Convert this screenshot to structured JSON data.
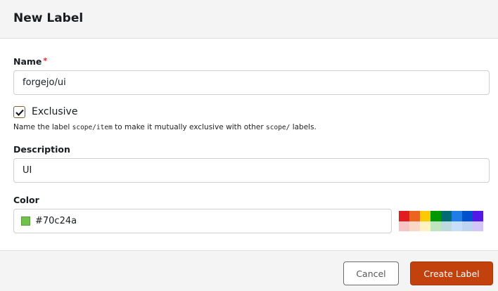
{
  "header": {
    "title": "New Label"
  },
  "name": {
    "label": "Name",
    "required_mark": "*",
    "value": "forgejo/ui"
  },
  "exclusive": {
    "label": "Exclusive",
    "checked": true,
    "help_pre": "Name the label ",
    "help_code1": "scope/item",
    "help_mid": " to make it mutually exclusive with other ",
    "help_code2": "scope/",
    "help_post": " labels."
  },
  "description": {
    "label": "Description",
    "value": "UI"
  },
  "color": {
    "label": "Color",
    "value": "#70c24a",
    "palette": [
      "#e11d21",
      "#eb6420",
      "#fbca04",
      "#009800",
      "#006b75",
      "#207de5",
      "#0052cc",
      "#5319e7",
      "#f6c6c7",
      "#fad8c7",
      "#fef2c0",
      "#bfe5bf",
      "#bfdadc",
      "#c7def8",
      "#bfd4f2",
      "#d4c5f9"
    ]
  },
  "buttons": {
    "cancel": "Cancel",
    "create": "Create Label"
  }
}
